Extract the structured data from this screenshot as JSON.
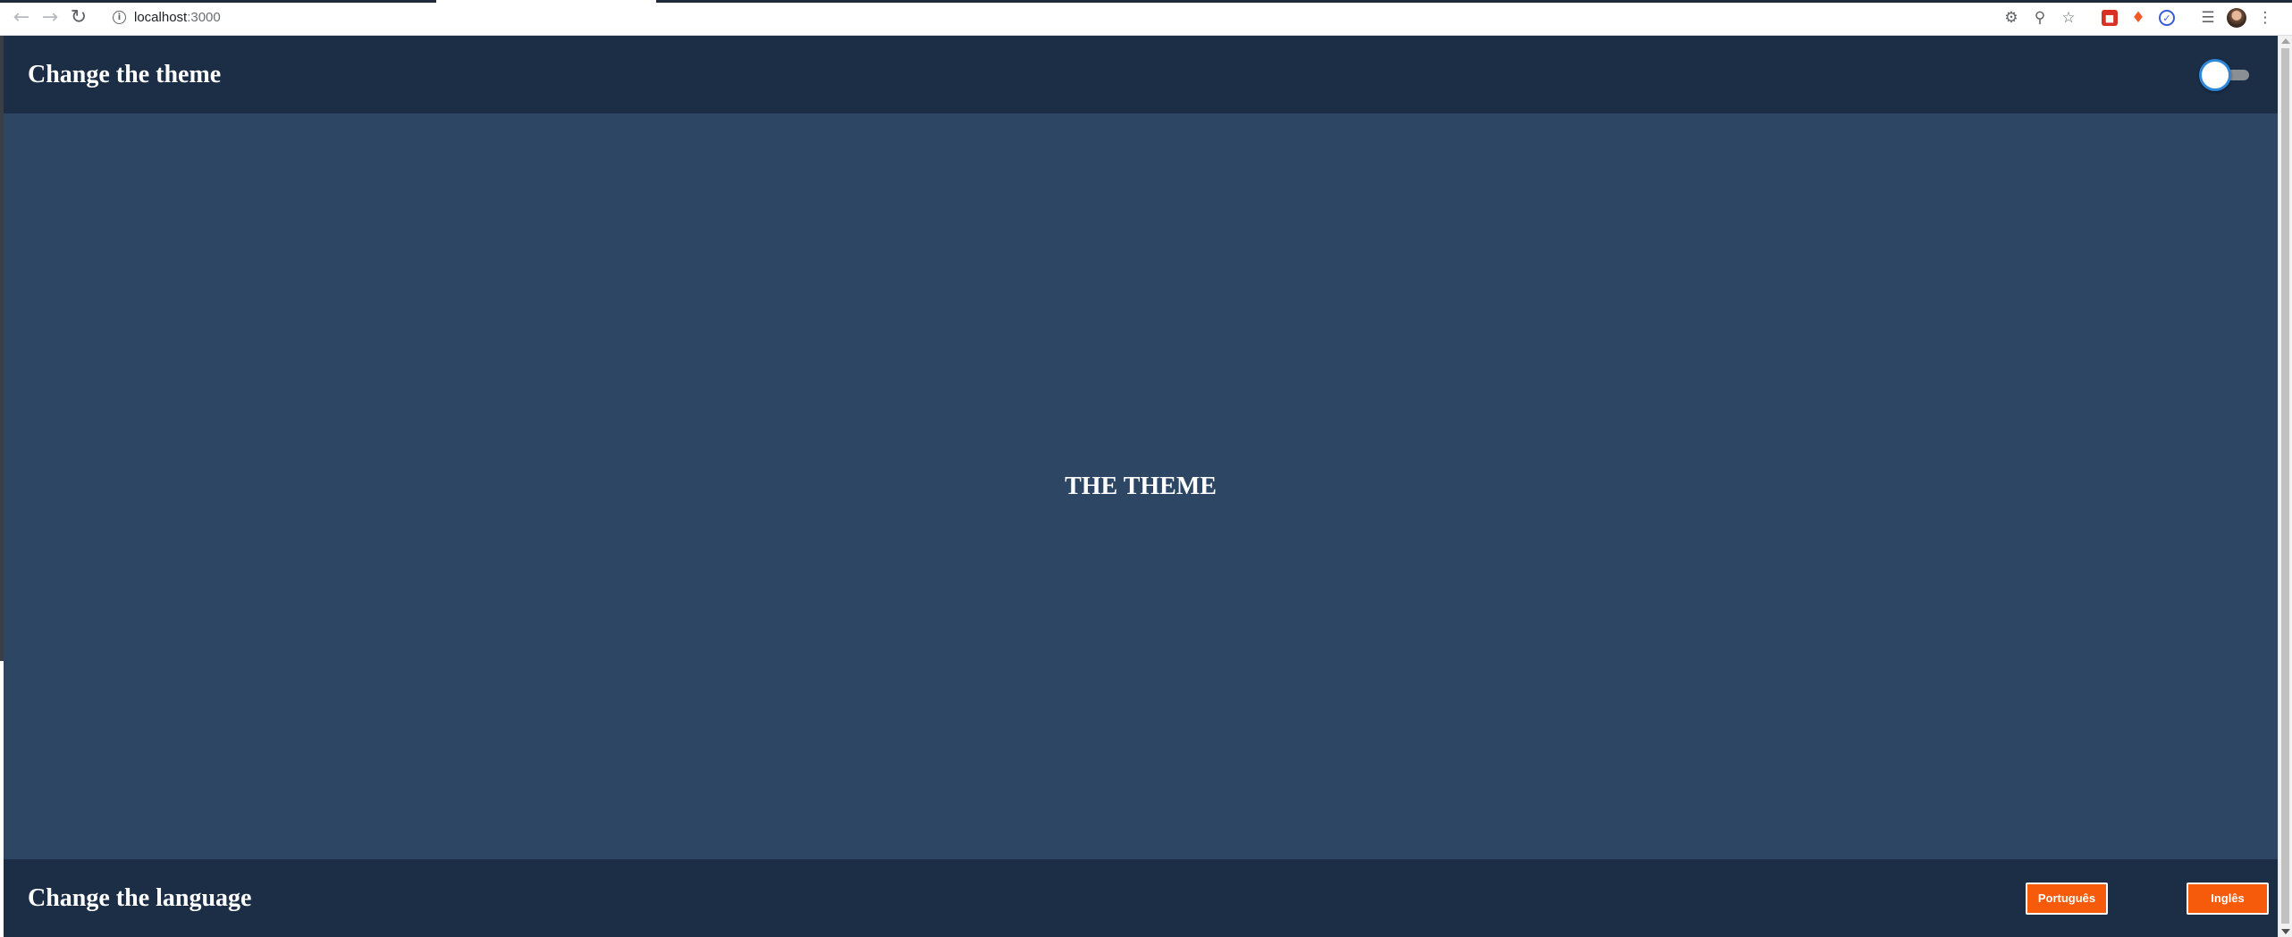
{
  "browser": {
    "url_host": "localhost",
    "url_port": ":3000",
    "back_icon": "arrow-left-icon",
    "forward_icon": "arrow-right-icon",
    "reload_icon": "reload-icon",
    "info_icon": "info-icon",
    "info_glyph": "i"
  },
  "header": {
    "title": "Change the theme",
    "toggle_state": "off"
  },
  "main": {
    "heading": "THE THEME"
  },
  "footer": {
    "title": "Change the language",
    "buttons": [
      {
        "label": "Português"
      },
      {
        "label": "Inglês"
      }
    ]
  },
  "colors": {
    "header_bg": "#1b2e46",
    "main_bg": "#2d4664",
    "accent": "#f55b0a",
    "toggle_ring": "#2f87d9"
  }
}
